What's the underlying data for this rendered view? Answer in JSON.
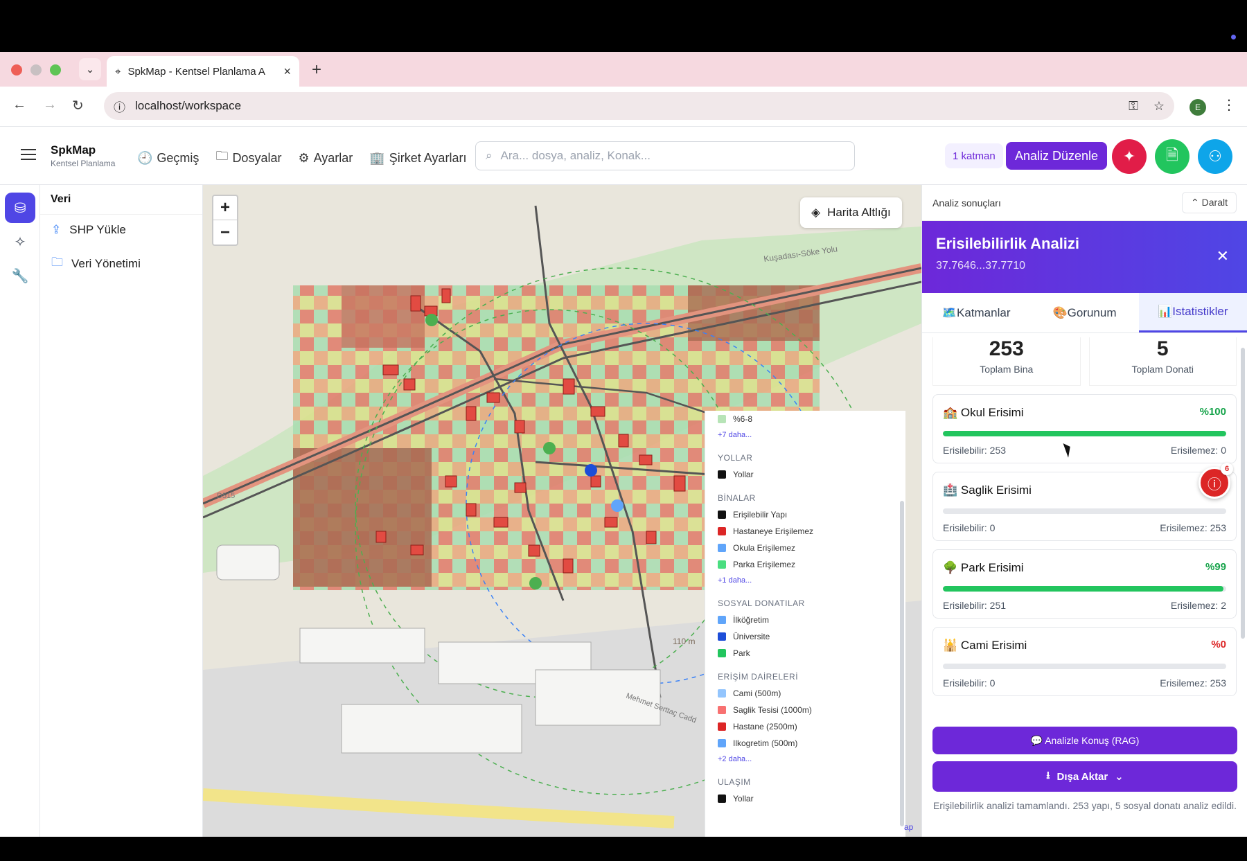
{
  "browser": {
    "tab_title": "SpkMap - Kentsel Planlama A",
    "url": "localhost/workspace",
    "profile_initial": "E"
  },
  "header": {
    "brand_name": "SpkMap",
    "brand_sub": "Kentsel Planlama",
    "nav": [
      "Geçmiş",
      "Dosyalar",
      "Ayarlar",
      "Şirket Ayarları"
    ],
    "search_placeholder": "Ara... dosya, analiz, Konak...",
    "layer_badge": "1 katman",
    "analiz_button": "Analiz Düzenle"
  },
  "sidepanel": {
    "title": "Veri",
    "items": [
      "SHP Yükle",
      "Veri Yönetimi"
    ]
  },
  "map": {
    "zoom_in": "+",
    "zoom_out": "−",
    "basemap_button": "Harita Altlığı",
    "scale_label": "110 m",
    "attribution": "ap",
    "road_label": "Kuşadası-Söke Yolu",
    "road_ref": "D515",
    "street_label": "Mehmet Serttaç Cadd"
  },
  "legend": {
    "top_item": "%6-8",
    "top_more": "+7 daha...",
    "sections": [
      {
        "title": "YOLLAR",
        "items": [
          {
            "label": "Yollar",
            "color": "#111111"
          }
        ]
      },
      {
        "title": "BİNALAR",
        "items": [
          {
            "label": "Erişilebilir Yapı",
            "color": "#111111"
          },
          {
            "label": "Hastaneye Erişilemez",
            "color": "#dc2626"
          },
          {
            "label": "Okula Erişilemez",
            "color": "#60a5fa"
          },
          {
            "label": "Parka Erişilemez",
            "color": "#4ade80"
          }
        ],
        "more": "+1 daha..."
      },
      {
        "title": "SOSYAL DONATILAR",
        "items": [
          {
            "label": "İlköğretim",
            "color": "#60a5fa"
          },
          {
            "label": "Üniversite",
            "color": "#1d4ed8"
          },
          {
            "label": "Park",
            "color": "#22c55e"
          }
        ]
      },
      {
        "title": "ERİŞİM DAİRELERİ",
        "items": [
          {
            "label": "Cami (500m)",
            "color": "#93c5fd"
          },
          {
            "label": "Saglik Tesisi (1000m)",
            "color": "#f87171"
          },
          {
            "label": "Hastane (2500m)",
            "color": "#dc2626"
          },
          {
            "label": "Ilkogretim (500m)",
            "color": "#60a5fa"
          }
        ],
        "more": "+2 daha..."
      },
      {
        "title": "ULAŞIM",
        "items": [
          {
            "label": "Yollar",
            "color": "#111111"
          }
        ]
      }
    ]
  },
  "analysis": {
    "section_title": "Analiz sonuçları",
    "collapse_label": "Daralt",
    "title": "Erisilebilirlik Analizi",
    "coords": "37.7646...37.7710",
    "tabs": [
      "Katmanlar",
      "Gorunum",
      "Istatistikler"
    ],
    "stats": [
      {
        "value": "253",
        "label": "Toplam Bina"
      },
      {
        "value": "5",
        "label": "Toplam Donati"
      }
    ],
    "cards": [
      {
        "emoji": "🏫",
        "title": "Okul Erisimi",
        "pct": "%100",
        "fill": 1.0,
        "pct_color": "#16a34a",
        "left": "Erisilebilir: 253",
        "right": "Erisilemez: 0"
      },
      {
        "emoji": "🏥",
        "title": "Saglik Erisimi",
        "pct": "",
        "fill": 0.0,
        "pct_color": "#dc2626",
        "left": "Erisilebilir: 0",
        "right": "Erisilemez: 253"
      },
      {
        "emoji": "🌳",
        "title": "Park Erisimi",
        "pct": "%99",
        "fill": 0.99,
        "pct_color": "#16a34a",
        "left": "Erisilebilir: 251",
        "right": "Erisilemez: 2"
      },
      {
        "emoji": "🕌",
        "title": "Cami Erisimi",
        "pct": "%0",
        "fill": 0.0,
        "pct_color": "#dc2626",
        "left": "Erisilebilir: 0",
        "right": "Erisilemez: 253"
      }
    ],
    "rag_button": "💬 Analizle Konuş (RAG)",
    "export_button": "Dışa Aktar",
    "footer": "Erişilebilirlik analizi tamamlandı. 253 yapı, 5 sosyal donatı analiz edildi.",
    "alert_count": "6"
  }
}
